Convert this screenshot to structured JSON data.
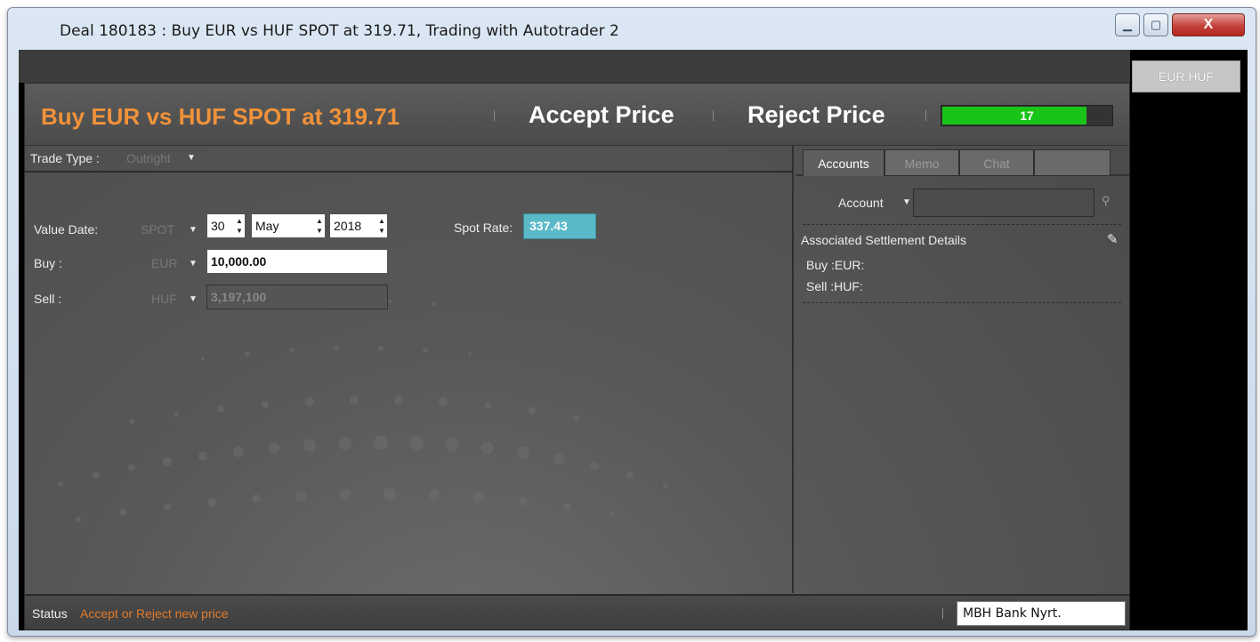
{
  "window": {
    "title": "Deal 180183 : Buy EUR vs HUF SPOT at 319.71, Trading with Autotrader 2",
    "close_glyph": "X"
  },
  "side_tab": {
    "label": "EUR.HUF"
  },
  "header": {
    "title": "Buy EUR vs HUF SPOT at 319.71",
    "accept_label": "Accept Price",
    "reject_label": "Reject Price",
    "countdown": "17",
    "countdown_fraction": 0.85,
    "countdown_color": "#19c419"
  },
  "form": {
    "trade_type_label": "Trade Type :",
    "trade_type_value": "Outright",
    "value_date_label": "Value Date:",
    "value_date_tenor": "SPOT",
    "day": "30",
    "month": "May",
    "year": "2018",
    "spot_rate_label": "Spot Rate:",
    "spot_rate": "337.43",
    "buy_label": "Buy :",
    "buy_ccy": "EUR",
    "buy_amount": "10,000.00",
    "sell_label": "Sell :",
    "sell_ccy": "HUF",
    "sell_amount": "3,197,100"
  },
  "right_panel": {
    "tabs": [
      "Accounts",
      "Memo",
      "Chat"
    ],
    "account_label": "Account",
    "account_value": "",
    "settlement_title": "Associated Settlement Details",
    "settlement_buy": "Buy :EUR:",
    "settlement_sell": "Sell :HUF:"
  },
  "status": {
    "label": "Status",
    "text": "Accept or Reject new price",
    "bank": "MBH Bank Nyrt."
  },
  "colors": {
    "accent_orange": "#f0923a",
    "spot_rate_bg": "#5ab9c7",
    "progress_green": "#19c419"
  }
}
